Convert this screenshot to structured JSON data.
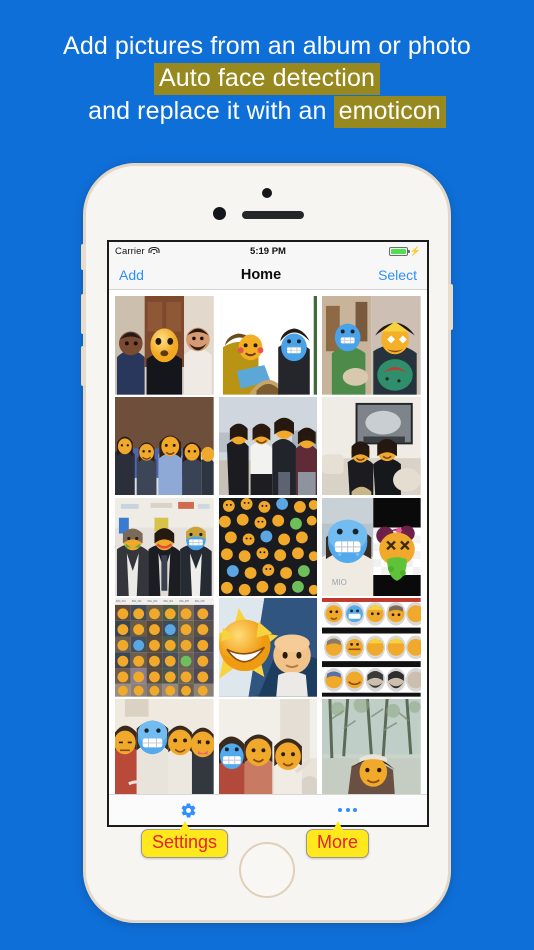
{
  "promo": {
    "line1": "Add pictures from an album or photo",
    "line2_highlight": "Auto face detection",
    "line3_prefix": "and replace it with an ",
    "line3_highlight": "emoticon",
    "background_color": "#0f6fd8",
    "highlight_color": "#97891f",
    "text_color": "#ffffff"
  },
  "device": {
    "frame_color": "#e5d7c6",
    "face_color": "#f7f5f2",
    "buttons": [
      "silent-switch",
      "volume-up",
      "volume-down",
      "power"
    ],
    "home_button": "home-button",
    "camera": "front-camera",
    "speaker": "earpiece-speaker"
  },
  "status_bar": {
    "carrier": "Carrier",
    "wifi_icon": "wifi-icon",
    "time": "5:19 PM",
    "battery_icon": "battery-full-icon",
    "battery_level": "100",
    "charging_icon": "lightning-bolt-icon",
    "battery_color": "#4ee04e"
  },
  "nav_bar": {
    "left_button": "Add",
    "title": "Home",
    "right_button": "Select",
    "tint_color": "#2f8fff"
  },
  "grid": {
    "columns": 3,
    "thumbnails": [
      {
        "id": "photo-1",
        "caption": "Three people indoors with emoji face"
      },
      {
        "id": "photo-2",
        "caption": "Two people reading with emoji faces"
      },
      {
        "id": "photo-3",
        "caption": "Man with pet and woman with emoji faces"
      },
      {
        "id": "photo-4",
        "caption": "Group of women with emoji faces"
      },
      {
        "id": "photo-5",
        "caption": "Four people standing outdoors with emoji faces"
      },
      {
        "id": "photo-6",
        "caption": "Couple on sofa with emoji faces"
      },
      {
        "id": "photo-7",
        "caption": "Three men in suits with emoji faces"
      },
      {
        "id": "photo-8",
        "caption": "Large crowd with emoji faces"
      },
      {
        "id": "photo-9",
        "caption": "Child with blue emoji and sick emoji sticker"
      },
      {
        "id": "photo-10",
        "caption": "Contact sheet grid of emoji faces"
      },
      {
        "id": "photo-11",
        "caption": "Star-struck emoji and bald person emoji"
      },
      {
        "id": "photo-12",
        "caption": "Rows of emoji portrait faces"
      },
      {
        "id": "photo-13",
        "caption": "Group selfie with emoji faces"
      },
      {
        "id": "photo-14",
        "caption": "Indoor group with emoji faces"
      },
      {
        "id": "photo-15",
        "caption": "Person in forest with emoji face"
      }
    ]
  },
  "tab_bar": {
    "items": [
      {
        "icon": "gear-icon",
        "callout": "Settings"
      },
      {
        "icon": "ellipsis-icon",
        "callout": "More"
      }
    ],
    "icon_color": "#2f8fff",
    "callout_bg": "#ffe81c",
    "callout_text_color": "#e8212a"
  }
}
